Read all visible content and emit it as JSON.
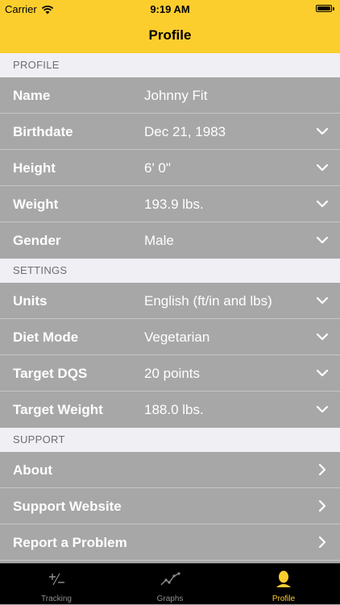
{
  "status_bar": {
    "carrier": "Carrier",
    "time": "9:19 AM"
  },
  "nav": {
    "title": "Profile"
  },
  "sections": [
    {
      "header": "PROFILE",
      "rows": [
        {
          "label": "Name",
          "value": "Johnny Fit",
          "accessory": "none"
        },
        {
          "label": "Birthdate",
          "value": "Dec 21, 1983",
          "accessory": "chevron-down"
        },
        {
          "label": "Height",
          "value": "6' 0\"",
          "accessory": "chevron-down"
        },
        {
          "label": "Weight",
          "value": "193.9 lbs.",
          "accessory": "chevron-down"
        },
        {
          "label": "Gender",
          "value": "Male",
          "accessory": "chevron-down"
        }
      ]
    },
    {
      "header": "SETTINGS",
      "rows": [
        {
          "label": "Units",
          "value": "English (ft/in and lbs)",
          "accessory": "chevron-down"
        },
        {
          "label": "Diet Mode",
          "value": "Vegetarian",
          "accessory": "chevron-down"
        },
        {
          "label": "Target DQS",
          "value": "20 points",
          "accessory": "chevron-down"
        },
        {
          "label": "Target Weight",
          "value": "188.0 lbs.",
          "accessory": "chevron-down"
        }
      ]
    },
    {
      "header": "SUPPORT",
      "rows": [
        {
          "label": "About",
          "value": "",
          "accessory": "chevron-right"
        },
        {
          "label": "Support Website",
          "value": "",
          "accessory": "chevron-right"
        },
        {
          "label": "Report a Problem",
          "value": "",
          "accessory": "chevron-right"
        }
      ]
    }
  ],
  "tabs": [
    {
      "label": "Tracking",
      "icon": "plus-minus-icon",
      "active": false
    },
    {
      "label": "Graphs",
      "icon": "graph-icon",
      "active": false
    },
    {
      "label": "Profile",
      "icon": "person-icon",
      "active": true
    }
  ],
  "colors": {
    "accent": "#fcce2d",
    "row_bg": "#a7a7a7",
    "header_bg": "#efeff4",
    "tab_bg": "#000000"
  }
}
